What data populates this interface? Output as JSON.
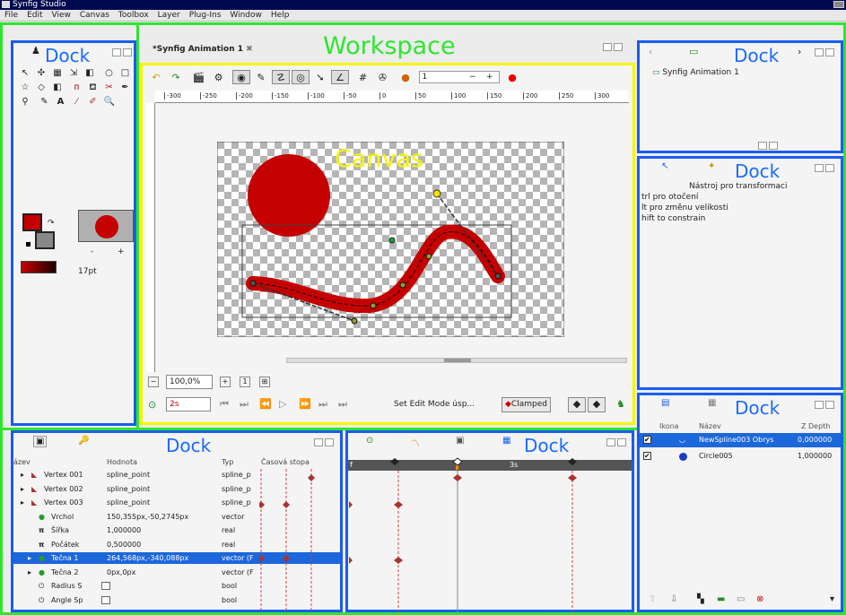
{
  "window": {
    "title": "Synfig Studio"
  },
  "menu": [
    "File",
    "Edit",
    "View",
    "Canvas",
    "Toolbox",
    "Layer",
    "Plug-Ins",
    "Window",
    "Help"
  ],
  "labels": {
    "dock": "Dock",
    "workspace": "Workspace",
    "canvas": "Canvas"
  },
  "colors": {
    "outline": "#2ee62e",
    "dock_border": "#1a5cf0",
    "canvas_border": "#f5f500",
    "accent_red": "#c40000",
    "selection": "#1c67d9"
  },
  "workspace": {
    "tab_title": "*Synfig Animation 1",
    "frame_value": "1",
    "ruler": [
      "-300",
      "-250",
      "-200",
      "-150",
      "-100",
      "-50",
      "0",
      "50",
      "100",
      "150",
      "200",
      "250",
      "300"
    ],
    "zoom": "100,0%",
    "time": "2s",
    "edit_mode": "Set Edit Mode úsp...",
    "interpolation": "Clamped"
  },
  "toolbox": {
    "tools": [
      "arrow-icon",
      "transform-icon",
      "smooth-move-icon",
      "scale-icon",
      "rotate-icon",
      "circle-icon",
      "rectangle-icon",
      "star-icon",
      "polygon-icon",
      "gradient-icon",
      "spline-icon",
      "fill-icon",
      "cut-icon",
      "feather-icon",
      "eyedropper-icon",
      "pencil-icon",
      "text-icon",
      "brush-icon",
      "draw-icon",
      "zoom-icon"
    ],
    "brush_size": "17pt"
  },
  "canvas_browser": {
    "item": "Synfig Animation 1"
  },
  "tool_options": {
    "title": "Nástroj pro transformaci",
    "lines": [
      "trl pro otočení",
      "lt pro změnu velikosti",
      "hift to constrain"
    ]
  },
  "layers": {
    "headers": {
      "icon": "Ikona",
      "name": "Název",
      "z": "Z Depth"
    },
    "rows": [
      {
        "name": "NewSpline003 Obrys",
        "z": "0,000000",
        "selected": true
      },
      {
        "name": "Circle005",
        "z": "1,000000",
        "selected": false
      }
    ]
  },
  "params": {
    "headers": {
      "name": "ázev",
      "value": "Hodnota",
      "type": "Typ",
      "timetrack": "Časová stopa"
    },
    "rows": [
      {
        "name": "Vertex 001",
        "value": "spline_point",
        "type": "spline_p",
        "indent": 1
      },
      {
        "name": "Vertex 002",
        "value": "spline_point",
        "type": "spline_p",
        "indent": 1
      },
      {
        "name": "Vertex 003",
        "value": "spline_point",
        "type": "spline_p",
        "indent": 1
      },
      {
        "name": "Vrchol",
        "value": "150,355px,-50,2745px",
        "type": "vector",
        "indent": 2
      },
      {
        "name": "Šířka",
        "value": "1,000000",
        "type": "real",
        "indent": 2
      },
      {
        "name": "Počátek",
        "value": "0,500000",
        "type": "real",
        "indent": 2
      },
      {
        "name": "Tečna 1",
        "value": "264,568px,-340,088px",
        "type": "vector (F",
        "indent": 2,
        "selected": true
      },
      {
        "name": "Tečna 2",
        "value": "0px,0px",
        "type": "vector (F",
        "indent": 2
      },
      {
        "name": "Radius S",
        "value": "",
        "type": "bool",
        "indent": 2
      },
      {
        "name": "Angle Sp",
        "value": "",
        "type": "bool",
        "indent": 2
      }
    ]
  },
  "timetrack": {
    "time_label": "3s"
  }
}
